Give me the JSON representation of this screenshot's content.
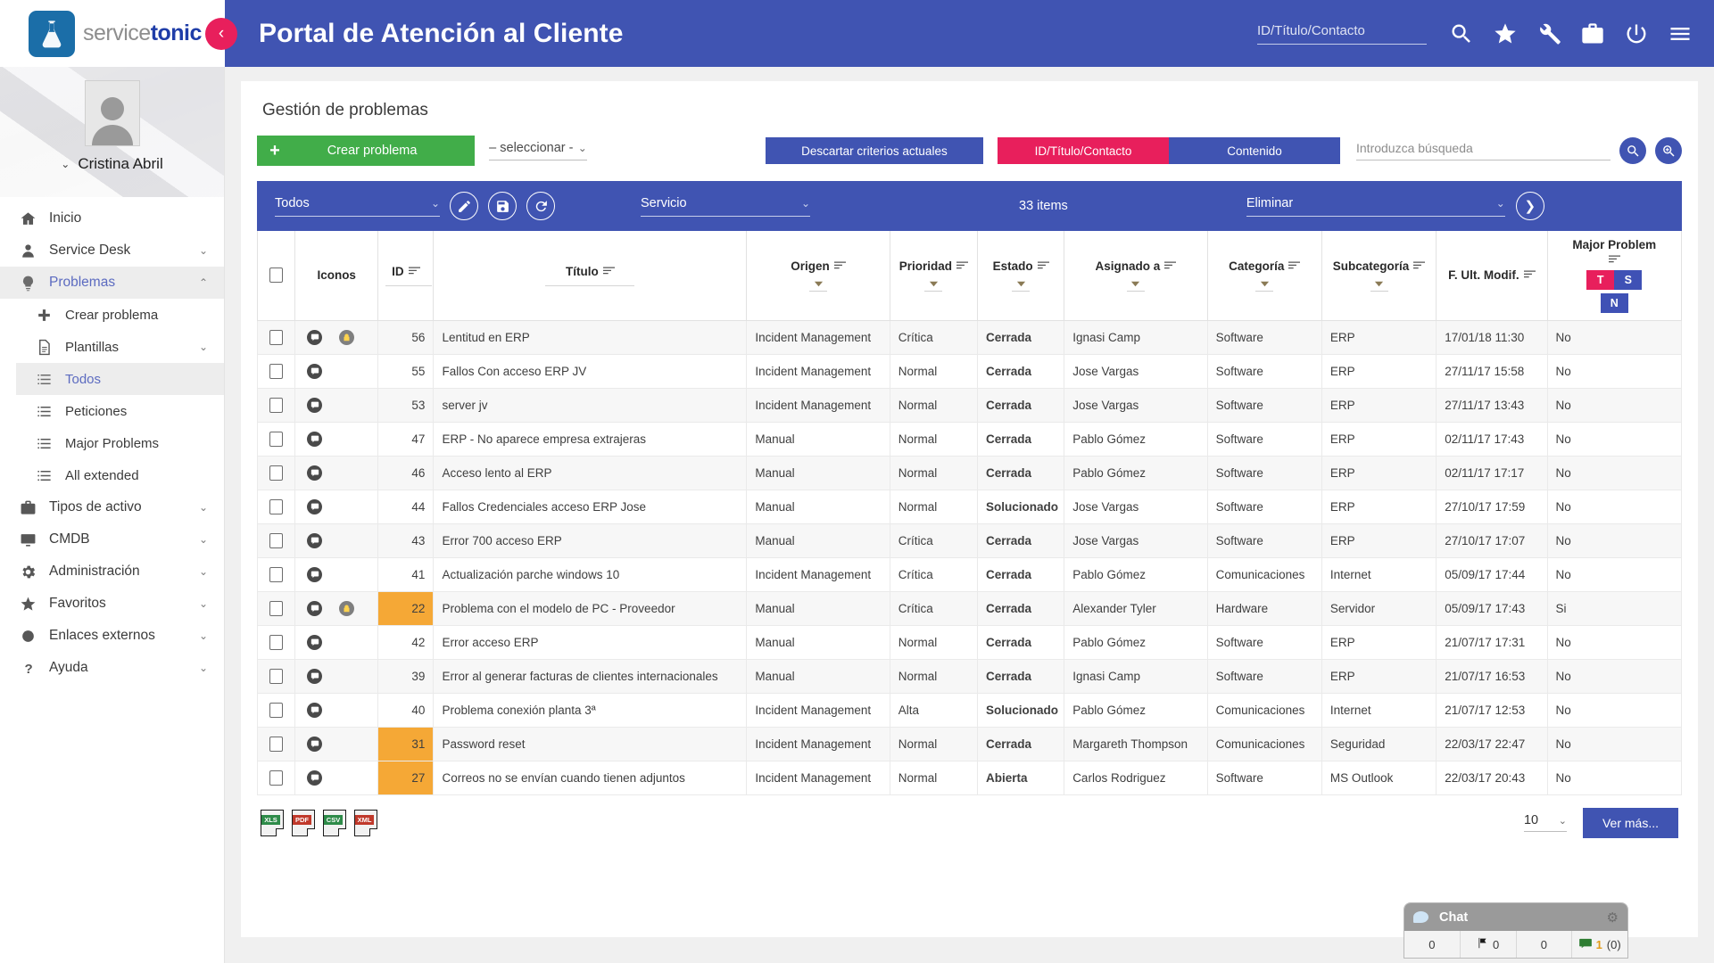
{
  "brand": {
    "name_light": "service",
    "name_bold": "tonic",
    "accent": "#4054b2",
    "pink": "#e81f5c",
    "green": "#41ad49",
    "orange": "#f5a836"
  },
  "header": {
    "title": "Portal de Atención al Cliente",
    "search_placeholder": "ID/Título/Contacto",
    "collapse_label": "‹",
    "icons": [
      "search-icon",
      "star-icon",
      "wrench-icon",
      "briefcase-icon",
      "power-icon",
      "menu-icon"
    ]
  },
  "sidebar": {
    "user": "Cristina Abril",
    "items": [
      {
        "label": "Inicio",
        "icon": "home-icon",
        "caret": "",
        "active": false,
        "sub": false
      },
      {
        "label": "Service Desk",
        "icon": "user-icon",
        "caret": "⌄",
        "active": false,
        "sub": false
      },
      {
        "label": "Problemas",
        "icon": "bulb-icon",
        "caret": "⌃",
        "active": true,
        "sub": false
      },
      {
        "label": "Crear problema",
        "icon": "plus-icon",
        "caret": "",
        "active": false,
        "sub": true
      },
      {
        "label": "Plantillas",
        "icon": "doc-icon",
        "caret": "⌄",
        "active": false,
        "sub": true
      },
      {
        "label": "Todos",
        "icon": "list-icon",
        "caret": "",
        "active": true,
        "sub": true
      },
      {
        "label": "Peticiones",
        "icon": "list-icon",
        "caret": "",
        "active": false,
        "sub": true
      },
      {
        "label": "Major Problems",
        "icon": "list-icon",
        "caret": "",
        "active": false,
        "sub": true
      },
      {
        "label": "All extended",
        "icon": "list-icon",
        "caret": "",
        "active": false,
        "sub": true
      },
      {
        "label": "Tipos de activo",
        "icon": "briefcase-icon",
        "caret": "⌄",
        "active": false,
        "sub": false
      },
      {
        "label": "CMDB",
        "icon": "monitor-icon",
        "caret": "⌄",
        "active": false,
        "sub": false
      },
      {
        "label": "Administración",
        "icon": "gear-icon",
        "caret": "⌄",
        "active": false,
        "sub": false
      },
      {
        "label": "Favoritos",
        "icon": "star-icon",
        "caret": "⌄",
        "active": false,
        "sub": false
      },
      {
        "label": "Enlaces externos",
        "icon": "circle-icon",
        "caret": "⌄",
        "active": false,
        "sub": false
      },
      {
        "label": "Ayuda",
        "icon": "question-icon",
        "caret": "⌄",
        "active": false,
        "sub": false
      }
    ]
  },
  "main": {
    "page_title": "Gestión de problemas",
    "create_button": "Crear problema",
    "create_plus": "+",
    "select_placeholder": "– seleccionar -",
    "discard_button": "Descartar criterios actuales",
    "seg_left": "ID/Título/Contacto",
    "seg_right": "Contenido",
    "search_placeholder": "Introduzca búsqueda"
  },
  "filterbar": {
    "view_select": "Todos",
    "service_select": "Servicio",
    "items_count": "33 items",
    "action_select": "Eliminar",
    "go": "❯",
    "icons": [
      "pencil-icon",
      "save-icon",
      "refresh-icon"
    ]
  },
  "table": {
    "columns": [
      {
        "label": "",
        "key": "check"
      },
      {
        "label": "Iconos",
        "key": "iconos"
      },
      {
        "label": "ID",
        "key": "id"
      },
      {
        "label": "Título",
        "key": "titulo"
      },
      {
        "label": "Origen",
        "key": "origen"
      },
      {
        "label": "Prioridad",
        "key": "prioridad"
      },
      {
        "label": "Estado",
        "key": "estado"
      },
      {
        "label": "Asignado a",
        "key": "asignado"
      },
      {
        "label": "Categoría",
        "key": "categoria"
      },
      {
        "label": "Subcategoría",
        "key": "subcategoria"
      },
      {
        "label": "F. Ult. Modif.",
        "key": "fecha"
      },
      {
        "label": "Major Problem",
        "key": "major"
      }
    ],
    "major_buttons": [
      "T",
      "S",
      "N"
    ],
    "rows": [
      {
        "lock": true,
        "id": "56",
        "id_hl": false,
        "titulo": "Lentitud en ERP",
        "origen": "Incident Management",
        "prioridad": "Crítica",
        "prio_class": "critica",
        "estado": "Cerrada",
        "asignado": "Ignasi Camp",
        "categoria": "Software",
        "subcategoria": "ERP",
        "fecha": "17/01/18 11:30",
        "major": "No"
      },
      {
        "lock": false,
        "id": "55",
        "id_hl": false,
        "titulo": "Fallos Con acceso ERP JV",
        "origen": "Incident Management",
        "prioridad": "Normal",
        "prio_class": "",
        "estado": "Cerrada",
        "asignado": "Jose Vargas",
        "categoria": "Software",
        "subcategoria": "ERP",
        "fecha": "27/11/17 15:58",
        "major": "No"
      },
      {
        "lock": false,
        "id": "53",
        "id_hl": false,
        "titulo": "server jv",
        "origen": "Incident Management",
        "prioridad": "Normal",
        "prio_class": "",
        "estado": "Cerrada",
        "asignado": "Jose Vargas",
        "categoria": "Software",
        "subcategoria": "ERP",
        "fecha": "27/11/17 13:43",
        "major": "No"
      },
      {
        "lock": false,
        "id": "47",
        "id_hl": false,
        "titulo": "ERP - No aparece empresa extrajeras",
        "origen": "Manual",
        "prioridad": "Normal",
        "prio_class": "",
        "estado": "Cerrada",
        "asignado": "Pablo Gómez",
        "categoria": "Software",
        "subcategoria": "ERP",
        "fecha": "02/11/17 17:43",
        "major": "No"
      },
      {
        "lock": false,
        "id": "46",
        "id_hl": false,
        "titulo": "Acceso lento al ERP",
        "origen": "Manual",
        "prioridad": "Normal",
        "prio_class": "",
        "estado": "Cerrada",
        "asignado": "Pablo Gómez",
        "categoria": "Software",
        "subcategoria": "ERP",
        "fecha": "02/11/17 17:17",
        "major": "No"
      },
      {
        "lock": false,
        "id": "44",
        "id_hl": false,
        "titulo": "Fallos Credenciales acceso ERP Jose",
        "origen": "Manual",
        "prioridad": "Normal",
        "prio_class": "",
        "estado": "Solucionado",
        "asignado": "Jose Vargas",
        "categoria": "Software",
        "subcategoria": "ERP",
        "fecha": "27/10/17 17:59",
        "major": "No"
      },
      {
        "lock": false,
        "id": "43",
        "id_hl": false,
        "titulo": "Error 700 acceso ERP",
        "origen": "Manual",
        "prioridad": "Crítica",
        "prio_class": "critica",
        "estado": "Cerrada",
        "asignado": "Jose Vargas",
        "categoria": "Software",
        "subcategoria": "ERP",
        "fecha": "27/10/17 17:07",
        "major": "No"
      },
      {
        "lock": false,
        "id": "41",
        "id_hl": false,
        "titulo": "Actualización parche windows 10",
        "origen": "Incident Management",
        "prioridad": "Crítica",
        "prio_class": "critica",
        "estado": "Cerrada",
        "asignado": "Pablo Gómez",
        "categoria": "Comunicaciones",
        "subcategoria": "Internet",
        "fecha": "05/09/17 17:44",
        "major": "No"
      },
      {
        "lock": true,
        "id": "22",
        "id_hl": true,
        "titulo": "Problema con el modelo de PC - Proveedor",
        "origen": "Manual",
        "prioridad": "Crítica",
        "prio_class": "critica",
        "estado": "Cerrada",
        "asignado": "Alexander Tyler",
        "categoria": "Hardware",
        "subcategoria": "Servidor",
        "fecha": "05/09/17 17:43",
        "major": "Si"
      },
      {
        "lock": false,
        "id": "42",
        "id_hl": false,
        "titulo": "Error acceso ERP",
        "origen": "Manual",
        "prioridad": "Normal",
        "prio_class": "",
        "estado": "Cerrada",
        "asignado": "Pablo Gómez",
        "categoria": "Software",
        "subcategoria": "ERP",
        "fecha": "21/07/17 17:31",
        "major": "No"
      },
      {
        "lock": false,
        "id": "39",
        "id_hl": false,
        "titulo": "Error al generar facturas de clientes internacionales",
        "origen": "Manual",
        "prioridad": "Normal",
        "prio_class": "",
        "estado": "Cerrada",
        "asignado": "Ignasi Camp",
        "categoria": "Software",
        "subcategoria": "ERP",
        "fecha": "21/07/17 16:53",
        "major": "No"
      },
      {
        "lock": false,
        "id": "40",
        "id_hl": false,
        "titulo": "Problema conexión planta 3ª",
        "origen": "Incident Management",
        "prioridad": "Alta",
        "prio_class": "alta",
        "estado": "Solucionado",
        "asignado": "Pablo Gómez",
        "categoria": "Comunicaciones",
        "subcategoria": "Internet",
        "fecha": "21/07/17 12:53",
        "major": "No"
      },
      {
        "lock": false,
        "id": "31",
        "id_hl": true,
        "titulo": "Password reset",
        "origen": "Incident Management",
        "prioridad": "Normal",
        "prio_class": "",
        "estado": "Cerrada",
        "asignado": "Margareth Thompson",
        "categoria": "Comunicaciones",
        "subcategoria": "Seguridad",
        "fecha": "22/03/17 22:47",
        "major": "No"
      },
      {
        "lock": false,
        "id": "27",
        "id_hl": true,
        "titulo": "Correos no se envían cuando tienen adjuntos",
        "origen": "Incident Management",
        "prioridad": "Normal",
        "prio_class": "",
        "estado": "Abierta",
        "asignado": "Carlos Rodriguez",
        "categoria": "Software",
        "subcategoria": "MS Outlook",
        "fecha": "22/03/17 20:43",
        "major": "No"
      }
    ]
  },
  "footer": {
    "exports": [
      {
        "label": "XLS",
        "color": "green"
      },
      {
        "label": "PDF",
        "color": "red"
      },
      {
        "label": "CSV",
        "color": "green"
      },
      {
        "label": "XML",
        "color": "red"
      }
    ],
    "page_size": "10",
    "more_button": "Ver más..."
  },
  "chat": {
    "title": "Chat",
    "stat1": "0",
    "stat2": "0",
    "stat3": "0",
    "stat4_num": "1",
    "stat4_paren": "(0)"
  }
}
